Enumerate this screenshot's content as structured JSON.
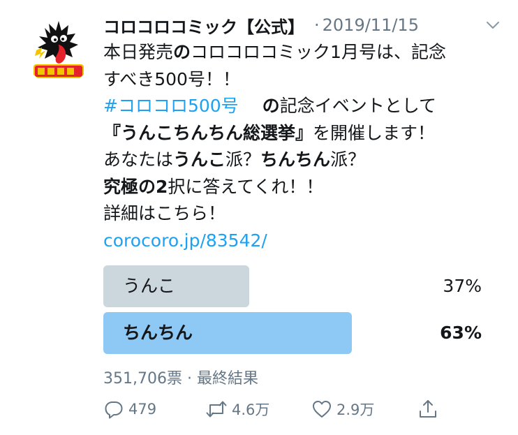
{
  "tweet": {
    "author": "コロコロコミック【公式】",
    "separator": "·",
    "date": "2019/11/15",
    "text": {
      "l1_a": "本日発売",
      "l1_b": "の",
      "l1_c": "コロコロコミック1月号は、記念",
      "l2": "すべき500号！！",
      "hashtag": "#コロコロ500号",
      "l3_b": "の",
      "l3_c": "記念イベントとして",
      "l4_a": "『うんこちんちん総選挙』",
      "l4_b": "を開催します！",
      "l5_a": "あなたは",
      "l5_b": "うんこ",
      "l5_c": "派？",
      "l5_d": "ちんちん",
      "l5_e": "派？",
      "l6_a": "究極の2",
      "l6_b": "択に答えてくれ！！",
      "l7": "詳細はこちら！",
      "link": "corocoro.jp/83542/"
    }
  },
  "poll": {
    "options": [
      {
        "label": "うんこ",
        "percent_text": "37%",
        "percent": 37,
        "color": "#ccd6dd",
        "winner": false
      },
      {
        "label": "ちんちん",
        "percent_text": "63%",
        "percent": 63,
        "color": "#8ec8f5",
        "winner": true
      }
    ],
    "votes": "351,706票",
    "meta_separator": "·",
    "status": "最終結果"
  },
  "actions": {
    "reply_icon": "reply-icon",
    "reply_count": "479",
    "retweet_icon": "retweet-icon",
    "retweet_count": "4.6万",
    "like_icon": "heart-icon",
    "like_count": "2.9万",
    "share_icon": "share-icon"
  },
  "colors": {
    "text": "#14171a",
    "secondary": "#657786",
    "link": "#1da1f2",
    "poll_loser": "#ccd6dd",
    "poll_winner": "#8ec8f5"
  }
}
